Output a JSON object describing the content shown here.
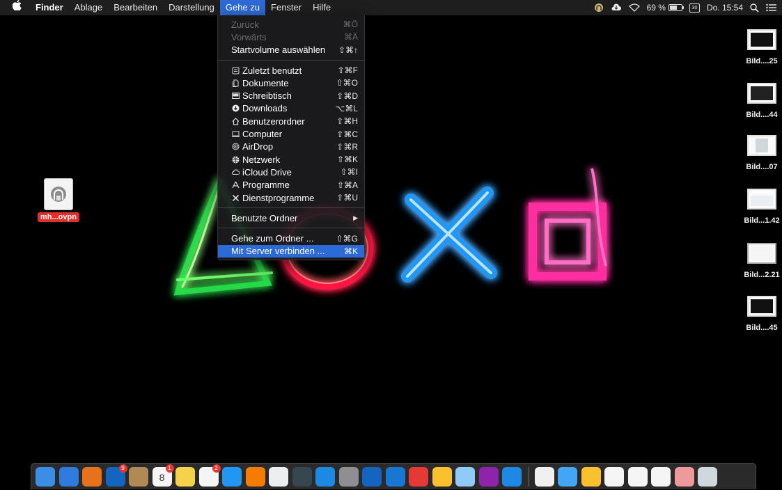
{
  "menubar": {
    "apple": "",
    "app_name": "Finder",
    "items": [
      "Ablage",
      "Bearbeiten",
      "Darstellung",
      "Gehe zu",
      "Fenster",
      "Hilfe"
    ],
    "active_item": "Gehe zu",
    "status": {
      "battery_percent": "69 %",
      "battery_fraction": 0.69,
      "calendar_day": "30",
      "clock": "Do. 15:54",
      "icons": [
        "vpn-tunnel-icon",
        "cloud-sync-icon",
        "wifi-icon",
        "battery-icon",
        "calendar-icon",
        "spotlight-icon",
        "notification-center-icon"
      ]
    }
  },
  "go_menu": {
    "group1": [
      {
        "label": "Zurück",
        "shortcut": "⌘Ö",
        "disabled": true
      },
      {
        "label": "Vorwärts",
        "shortcut": "⌘Ä",
        "disabled": true
      },
      {
        "label": "Startvolume auswählen",
        "shortcut": "⇧⌘↑",
        "disabled": false
      }
    ],
    "group2": [
      {
        "label": "Zuletzt benutzt",
        "shortcut": "⇧⌘F",
        "icon": "recents-icon"
      },
      {
        "label": "Dokumente",
        "shortcut": "⇧⌘O",
        "icon": "documents-icon"
      },
      {
        "label": "Schreibtisch",
        "shortcut": "⇧⌘D",
        "icon": "desktop-icon"
      },
      {
        "label": "Downloads",
        "shortcut": "⌥⌘L",
        "icon": "downloads-icon"
      },
      {
        "label": "Benutzerordner",
        "shortcut": "⇧⌘H",
        "icon": "home-icon"
      },
      {
        "label": "Computer",
        "shortcut": "⇧⌘C",
        "icon": "computer-icon"
      },
      {
        "label": "AirDrop",
        "shortcut": "⇧⌘R",
        "icon": "airdrop-icon"
      },
      {
        "label": "Netzwerk",
        "shortcut": "⇧⌘K",
        "icon": "network-icon"
      },
      {
        "label": "iCloud Drive",
        "shortcut": "⇧⌘I",
        "icon": "icloud-icon"
      },
      {
        "label": "Programme",
        "shortcut": "⇧⌘A",
        "icon": "applications-icon"
      },
      {
        "label": "Dienstprogramme",
        "shortcut": "⇧⌘U",
        "icon": "utilities-icon"
      }
    ],
    "group3": [
      {
        "label": "Benutzte Ordner",
        "shortcut": "▶"
      }
    ],
    "group4": [
      {
        "label": "Gehe zum Ordner ...",
        "shortcut": "⇧⌘G",
        "highlighted": false
      },
      {
        "label": "Mit Server verbinden ...",
        "shortcut": "⌘K",
        "highlighted": true
      }
    ]
  },
  "desktop": {
    "vpn_file": {
      "label": "mh...ovpn"
    },
    "screenshots": [
      "Bild....25",
      "Bild....44",
      "Bild....07",
      "Bild...1.42",
      "Bild...2.21",
      "Bild....45"
    ]
  },
  "dock": {
    "apps": [
      {
        "name": "finder-icon",
        "color": "#3a8ee6"
      },
      {
        "name": "safari-icon",
        "color": "#2f7be0"
      },
      {
        "name": "firefox-icon",
        "color": "#e8711b"
      },
      {
        "name": "outlook-icon",
        "color": "#1565c0",
        "badge": "9"
      },
      {
        "name": "contacts-icon",
        "color": "#b08a55"
      },
      {
        "name": "calendar-icon",
        "color": "#f5f5f5",
        "badge": "1",
        "text": "8"
      },
      {
        "name": "notes-icon",
        "color": "#f4d34a"
      },
      {
        "name": "reminders-icon",
        "color": "#f5f5f5",
        "badge": "2"
      },
      {
        "name": "app-store-icon",
        "color": "#2196f3"
      },
      {
        "name": "fl-studio-icon",
        "color": "#f57c00"
      },
      {
        "name": "sourcetree-icon",
        "color": "#eceff1"
      },
      {
        "name": "inkscape-icon",
        "color": "#37474f"
      },
      {
        "name": "virtualbox-icon",
        "color": "#1e88e5"
      },
      {
        "name": "system-preferences-icon",
        "color": "#8e8e93"
      },
      {
        "name": "wireshark-icon",
        "color": "#1565c0"
      },
      {
        "name": "vscode-icon",
        "color": "#1976d2"
      },
      {
        "name": "remote-desktop-icon",
        "color": "#e53935"
      },
      {
        "name": "cyberduck-icon",
        "color": "#fbc02d"
      },
      {
        "name": "keychain-icon",
        "color": "#90caf9"
      },
      {
        "name": "affinity-photo-icon",
        "color": "#8e24aa"
      },
      {
        "name": "affinity-designer-icon",
        "color": "#1e88e5"
      }
    ],
    "stacks": [
      {
        "name": "home-folder-icon",
        "color": "#f0f0f0"
      },
      {
        "name": "folder-icon",
        "color": "#42a5f5"
      },
      {
        "name": "cyberduck-stack-icon",
        "color": "#fbc02d"
      },
      {
        "name": "document-stack-icon",
        "color": "#f5f5f5"
      },
      {
        "name": "pdf-stack-icon",
        "color": "#f5f5f5"
      },
      {
        "name": "screenshot-stack-icon",
        "color": "#f5f5f5"
      },
      {
        "name": "image-stack-icon",
        "color": "#ef9a9a"
      },
      {
        "name": "trash-icon",
        "color": "#cfd8dc"
      }
    ]
  }
}
